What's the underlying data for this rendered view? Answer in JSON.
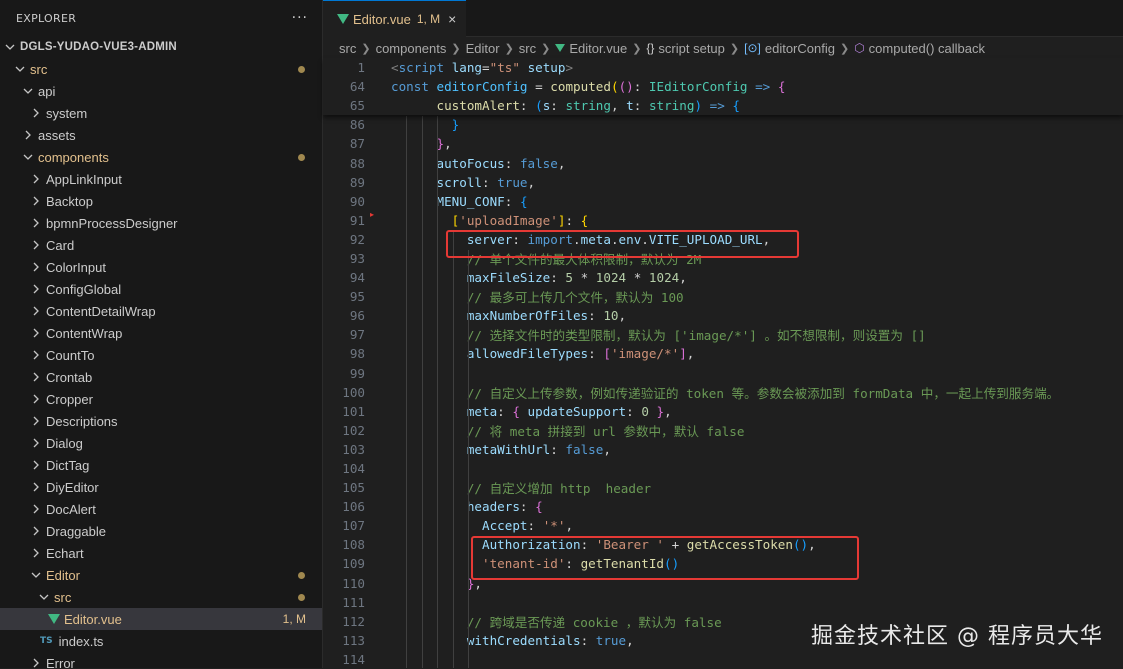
{
  "explorer": {
    "title": "EXPLORER",
    "more": "···",
    "root": "DGLS-YUDAO-VUE3-ADMIN",
    "items": [
      {
        "label": "src",
        "indent": 1,
        "open": true,
        "mod": true,
        "dot": true
      },
      {
        "label": "api",
        "indent": 2,
        "open": true,
        "mod": false
      },
      {
        "label": "system",
        "indent": 3,
        "open": false,
        "mod": false
      },
      {
        "label": "assets",
        "indent": 2,
        "open": false,
        "mod": false
      },
      {
        "label": "components",
        "indent": 2,
        "open": true,
        "mod": true,
        "dot": true
      },
      {
        "label": "AppLinkInput",
        "indent": 3,
        "open": false,
        "mod": false
      },
      {
        "label": "Backtop",
        "indent": 3,
        "open": false,
        "mod": false
      },
      {
        "label": "bpmnProcessDesigner",
        "indent": 3,
        "open": false,
        "mod": false
      },
      {
        "label": "Card",
        "indent": 3,
        "open": false,
        "mod": false
      },
      {
        "label": "ColorInput",
        "indent": 3,
        "open": false,
        "mod": false
      },
      {
        "label": "ConfigGlobal",
        "indent": 3,
        "open": false,
        "mod": false
      },
      {
        "label": "ContentDetailWrap",
        "indent": 3,
        "open": false,
        "mod": false
      },
      {
        "label": "ContentWrap",
        "indent": 3,
        "open": false,
        "mod": false
      },
      {
        "label": "CountTo",
        "indent": 3,
        "open": false,
        "mod": false
      },
      {
        "label": "Crontab",
        "indent": 3,
        "open": false,
        "mod": false
      },
      {
        "label": "Cropper",
        "indent": 3,
        "open": false,
        "mod": false
      },
      {
        "label": "Descriptions",
        "indent": 3,
        "open": false,
        "mod": false
      },
      {
        "label": "Dialog",
        "indent": 3,
        "open": false,
        "mod": false
      },
      {
        "label": "DictTag",
        "indent": 3,
        "open": false,
        "mod": false
      },
      {
        "label": "DiyEditor",
        "indent": 3,
        "open": false,
        "mod": false
      },
      {
        "label": "DocAlert",
        "indent": 3,
        "open": false,
        "mod": false
      },
      {
        "label": "Draggable",
        "indent": 3,
        "open": false,
        "mod": false
      },
      {
        "label": "Echart",
        "indent": 3,
        "open": false,
        "mod": false
      },
      {
        "label": "Editor",
        "indent": 3,
        "open": true,
        "mod": true,
        "dot": true
      },
      {
        "label": "src",
        "indent": 4,
        "open": true,
        "mod": true,
        "dot": true
      },
      {
        "label": "Editor.vue",
        "indent": 5,
        "file": "vue",
        "mod": true,
        "badge": "1, M",
        "selected": true
      },
      {
        "label": "index.ts",
        "indent": 4,
        "file": "ts",
        "mod": false
      },
      {
        "label": "Error",
        "indent": 3,
        "open": false,
        "mod": false
      }
    ]
  },
  "tab": {
    "name": "Editor.vue",
    "status": "1, M",
    "close": "×"
  },
  "breadcrumb": [
    "src",
    "components",
    "Editor",
    "src",
    "Editor.vue",
    "script setup",
    "editorConfig",
    "computed() callback"
  ],
  "watermark": "掘金技术社区 @ 程序员大华",
  "colors": {
    "accent": "#0078d4",
    "highlight": "#e53935",
    "modified": "#e2c08d"
  }
}
